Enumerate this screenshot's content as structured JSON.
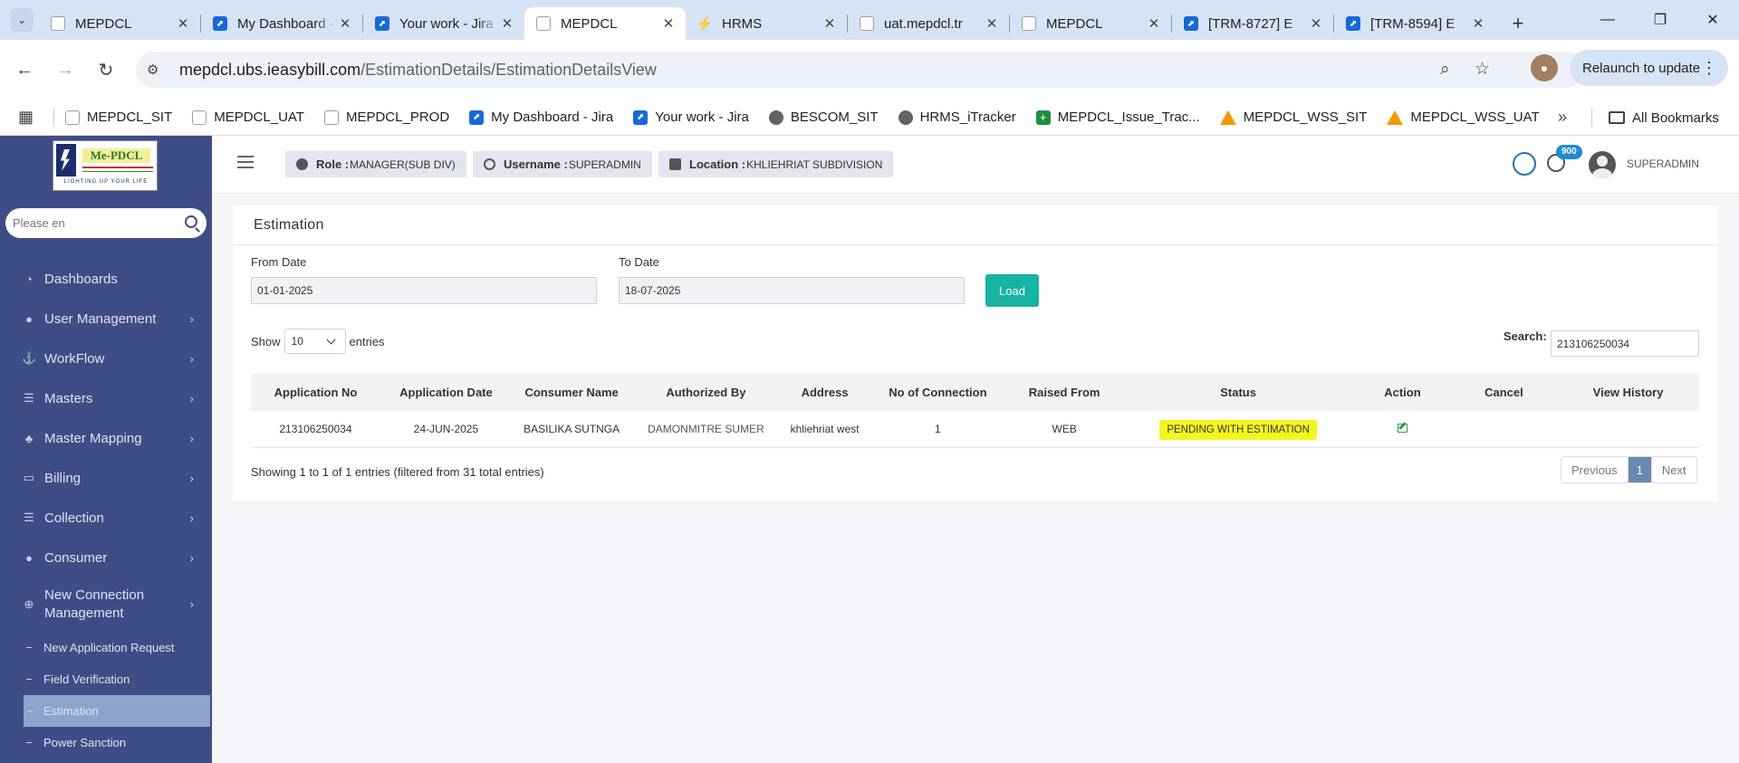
{
  "browser": {
    "tabs": [
      {
        "title": "MEPDCL",
        "icon": "doc"
      },
      {
        "title": "My Dashboard - Jira",
        "icon": "jira"
      },
      {
        "title": "Your work - Jira",
        "icon": "jira"
      },
      {
        "title": "MEPDCL",
        "icon": "doc",
        "active": true
      },
      {
        "title": "HRMS",
        "icon": "hrms"
      },
      {
        "title": "uat.mepdcl.tr",
        "icon": "doc"
      },
      {
        "title": "MEPDCL",
        "icon": "doc"
      },
      {
        "title": "[TRM-8727] E",
        "icon": "jira"
      },
      {
        "title": "[TRM-8594] E",
        "icon": "jira"
      }
    ],
    "url_host": "mepdcl.ubs.ieasybill.com",
    "url_path": "/EstimationDetails/EstimationDetailsView",
    "relaunch_label": "Relaunch to update",
    "bookmarks": [
      {
        "label": "MEPDCL_SIT",
        "icon": "doc"
      },
      {
        "label": "MEPDCL_UAT",
        "icon": "doc"
      },
      {
        "label": "MEPDCL_PROD",
        "icon": "doc"
      },
      {
        "label": "My Dashboard - Jira",
        "icon": "jira"
      },
      {
        "label": "Your work - Jira",
        "icon": "jira"
      },
      {
        "label": "BESCOM_SIT",
        "icon": "globe"
      },
      {
        "label": "HRMS_iTracker",
        "icon": "globe"
      },
      {
        "label": "MEPDCL_Issue_Trac...",
        "icon": "green"
      },
      {
        "label": "MEPDCL_WSS_SIT",
        "icon": "warn"
      },
      {
        "label": "MEPDCL_WSS_UAT",
        "icon": "warn"
      }
    ],
    "all_bookmarks_label": "All Bookmarks"
  },
  "logo": {
    "name": "Me-PDCL",
    "tagline": "LIGHTING UP YOUR LIFE"
  },
  "sidebar": {
    "search_placeholder": "Please en",
    "items": [
      {
        "label": "Dashboards",
        "icon": "dashboard-icon",
        "chevron": false
      },
      {
        "label": "User Management",
        "icon": "user-icon",
        "chevron": true
      },
      {
        "label": "WorkFlow",
        "icon": "anchor-icon",
        "chevron": true
      },
      {
        "label": "Masters",
        "icon": "list-icon",
        "chevron": true
      },
      {
        "label": "Master Mapping",
        "icon": "sitemap-icon",
        "chevron": true
      },
      {
        "label": "Billing",
        "icon": "monitor-icon",
        "chevron": true
      },
      {
        "label": "Collection",
        "icon": "list-icon",
        "chevron": true
      },
      {
        "label": "Consumer",
        "icon": "user-icon",
        "chevron": true
      },
      {
        "label": "New Connection Management",
        "icon": "plus-circle-icon",
        "chevron": true
      }
    ],
    "subitems": [
      {
        "label": "New Application Request"
      },
      {
        "label": "Field Verification"
      },
      {
        "label": "Estimation",
        "active": true
      },
      {
        "label": "Power Sanction"
      }
    ]
  },
  "header": {
    "role_label": "Role :",
    "role_value": "MANAGER(SUB DIV)",
    "username_label": "Username :",
    "username_value": "SUPERADMIN",
    "location_label": "Location :",
    "location_value": "KHLIEHRIAT SUBDIVISION",
    "notification_count": "900",
    "user": "SUPERADMIN"
  },
  "estimation": {
    "title": "Estimation",
    "from_date_label": "From Date",
    "from_date_value": "01-01-2025",
    "to_date_label": "To Date",
    "to_date_value": "18-07-2025",
    "load_label": "Load",
    "show_label": "Show",
    "entries_label": "entries",
    "page_size": "10",
    "search_label": "Search:",
    "search_value": "213106250034",
    "columns": [
      "Application No",
      "Application Date",
      "Consumer Name",
      "Authorized By",
      "Address",
      "No of Connection",
      "Raised From",
      "Status",
      "Action",
      "Cancel",
      "View History"
    ],
    "rows": [
      {
        "application_no": "213106250034",
        "application_date": "24-JUN-2025",
        "consumer_name": "BASILIKA SUTNGA",
        "authorized_by": "DAMONMITRE SUMER",
        "address": "khliehriat west",
        "connections": "1",
        "raised_from": "WEB",
        "status": "PENDING WITH ESTIMATION"
      }
    ],
    "info_text": "Showing 1 to 1 of 1 entries (filtered from 31 total entries)",
    "pager": {
      "previous": "Previous",
      "page": "1",
      "next": "Next"
    }
  }
}
